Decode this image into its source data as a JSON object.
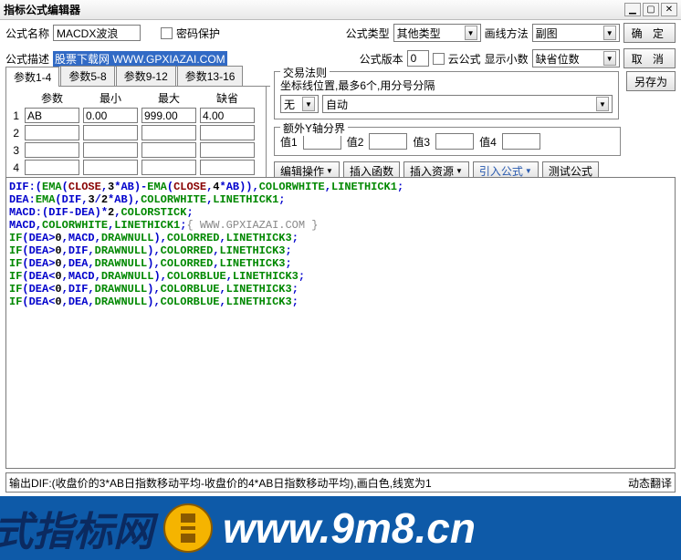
{
  "window": {
    "title": "指标公式编辑器"
  },
  "labels": {
    "formula_name": "公式名称",
    "pwd_protect": "密码保护",
    "formula_type": "公式类型",
    "draw_method": "画线方法",
    "formula_desc": "公式描述",
    "formula_ver": "公式版本",
    "cloud_formula": "云公式",
    "show_dec": "显示小数",
    "ok": "确 定",
    "cancel": "取 消",
    "save_as": "另存为",
    "trade_rule": "交易法则",
    "coord_hint": "坐标线位置,最多6个,用分号分隔",
    "extra_y": "额外Y轴分界",
    "val1": "值1",
    "val2": "值2",
    "val3": "值3",
    "val4": "值4",
    "edit_op": "编辑操作",
    "ins_func": "插入函数",
    "ins_res": "插入资源",
    "import_f": "引入公式",
    "test_f": "测试公式",
    "tabs": [
      "参数1-4",
      "参数5-8",
      "参数9-12",
      "参数13-16"
    ],
    "param_hd": [
      "参数",
      "最小",
      "最大",
      "缺省"
    ],
    "dyn_trans": "动态翻译"
  },
  "values": {
    "name": "MACDX波浪",
    "desc": " 股票下载网 WWW.GPXIAZAI.COM",
    "type_sel": "其他类型",
    "draw_sel": "副图",
    "ver": "0",
    "dec_sel": "缺省位数",
    "trade_sel": "无",
    "coord_sel": "自动",
    "v1": "",
    "v2": "",
    "v3": "",
    "v4": ""
  },
  "params": [
    {
      "n": "1",
      "name": "AB",
      "min": "0.00",
      "max": "999.00",
      "def": "4.00"
    },
    {
      "n": "2",
      "name": "",
      "min": "",
      "max": "",
      "def": ""
    },
    {
      "n": "3",
      "name": "",
      "min": "",
      "max": "",
      "def": ""
    },
    {
      "n": "4",
      "name": "",
      "min": "",
      "max": "",
      "def": ""
    }
  ],
  "code": [
    {
      "s": [
        [
          "DIF:(",
          "blue"
        ],
        [
          "EMA",
          "green"
        ],
        [
          "(",
          "blue"
        ],
        [
          "CLOSE",
          "dred"
        ],
        [
          ",",
          "blue"
        ],
        [
          "3",
          "black"
        ],
        [
          "*AB)-",
          "blue"
        ],
        [
          "EMA",
          "green"
        ],
        [
          "(",
          "blue"
        ],
        [
          "CLOSE",
          "dred"
        ],
        [
          ",",
          "blue"
        ],
        [
          "4",
          "black"
        ],
        [
          "*AB)),",
          "blue"
        ],
        [
          "COLORWHITE",
          "green"
        ],
        [
          ",",
          "blue"
        ],
        [
          "LINETHICK1",
          "green"
        ],
        [
          ";",
          "blue"
        ]
      ]
    },
    {
      "s": [
        [
          "DEA:",
          "blue"
        ],
        [
          "EMA",
          "green"
        ],
        [
          "(DIF,",
          "blue"
        ],
        [
          "3",
          "black"
        ],
        [
          "/",
          "blue"
        ],
        [
          "2",
          "black"
        ],
        [
          "*AB),",
          "blue"
        ],
        [
          "COLORWHITE",
          "green"
        ],
        [
          ",",
          "blue"
        ],
        [
          "LINETHICK1",
          "green"
        ],
        [
          ";",
          "blue"
        ]
      ]
    },
    {
      "s": [
        [
          "MACD:(DIF-DEA)*",
          "blue"
        ],
        [
          "2",
          "black"
        ],
        [
          ",",
          "blue"
        ],
        [
          "COLORSTICK",
          "green"
        ],
        [
          ";",
          "blue"
        ]
      ]
    },
    {
      "s": [
        [
          "MACD",
          "blue"
        ],
        [
          ",",
          "blue"
        ],
        [
          "COLORWHITE",
          "green"
        ],
        [
          ",",
          "blue"
        ],
        [
          "LINETHICK1",
          "green"
        ],
        [
          ";",
          "blue"
        ],
        [
          "{ WWW.GPXIAZAI.COM }",
          "gray"
        ]
      ]
    },
    {
      "s": [
        [
          "IF",
          "green"
        ],
        [
          "(DEA>",
          "blue"
        ],
        [
          "0",
          "black"
        ],
        [
          ",MACD,",
          "blue"
        ],
        [
          "DRAWNULL",
          "green"
        ],
        [
          "),",
          "blue"
        ],
        [
          "COLORRED",
          "green"
        ],
        [
          ",",
          "blue"
        ],
        [
          "LINETHICK3",
          "green"
        ],
        [
          ";",
          "blue"
        ]
      ]
    },
    {
      "s": [
        [
          "IF",
          "green"
        ],
        [
          "(DEA>",
          "blue"
        ],
        [
          "0",
          "black"
        ],
        [
          ",DIF,",
          "blue"
        ],
        [
          "DRAWNULL",
          "green"
        ],
        [
          "),",
          "blue"
        ],
        [
          "COLORRED",
          "green"
        ],
        [
          ",",
          "blue"
        ],
        [
          "LINETHICK3",
          "green"
        ],
        [
          ";",
          "blue"
        ]
      ]
    },
    {
      "s": [
        [
          "IF",
          "green"
        ],
        [
          "(DEA>",
          "blue"
        ],
        [
          "0",
          "black"
        ],
        [
          ",DEA,",
          "blue"
        ],
        [
          "DRAWNULL",
          "green"
        ],
        [
          "),",
          "blue"
        ],
        [
          "COLORRED",
          "green"
        ],
        [
          ",",
          "blue"
        ],
        [
          "LINETHICK3",
          "green"
        ],
        [
          ";",
          "blue"
        ]
      ]
    },
    {
      "s": [
        [
          "IF",
          "green"
        ],
        [
          "(DEA<",
          "blue"
        ],
        [
          "0",
          "black"
        ],
        [
          ",MACD,",
          "blue"
        ],
        [
          "DRAWNULL",
          "green"
        ],
        [
          "),",
          "blue"
        ],
        [
          "COLORBLUE",
          "green"
        ],
        [
          ",",
          "blue"
        ],
        [
          "LINETHICK3",
          "green"
        ],
        [
          ";",
          "blue"
        ]
      ]
    },
    {
      "s": [
        [
          "IF",
          "green"
        ],
        [
          "(DEA<",
          "blue"
        ],
        [
          "0",
          "black"
        ],
        [
          ",DIF,",
          "blue"
        ],
        [
          "DRAWNULL",
          "green"
        ],
        [
          "),",
          "blue"
        ],
        [
          "COLORBLUE",
          "green"
        ],
        [
          ",",
          "blue"
        ],
        [
          "LINETHICK3",
          "green"
        ],
        [
          ";",
          "blue"
        ]
      ]
    },
    {
      "s": [
        [
          "IF",
          "green"
        ],
        [
          "(DEA<",
          "blue"
        ],
        [
          "0",
          "black"
        ],
        [
          ",DEA,",
          "blue"
        ],
        [
          "DRAWNULL",
          "green"
        ],
        [
          "),",
          "blue"
        ],
        [
          "COLORBLUE",
          "green"
        ],
        [
          ",",
          "blue"
        ],
        [
          "LINETHICK3",
          "green"
        ],
        [
          ";",
          "blue"
        ]
      ]
    }
  ],
  "status": "输出DIF:(收盘价的3*AB日指数移动平均-收盘价的4*AB日指数移动平均),画白色,线宽为1",
  "watermark": {
    "left": "式指标网",
    "url": "www.9m8.cn"
  }
}
